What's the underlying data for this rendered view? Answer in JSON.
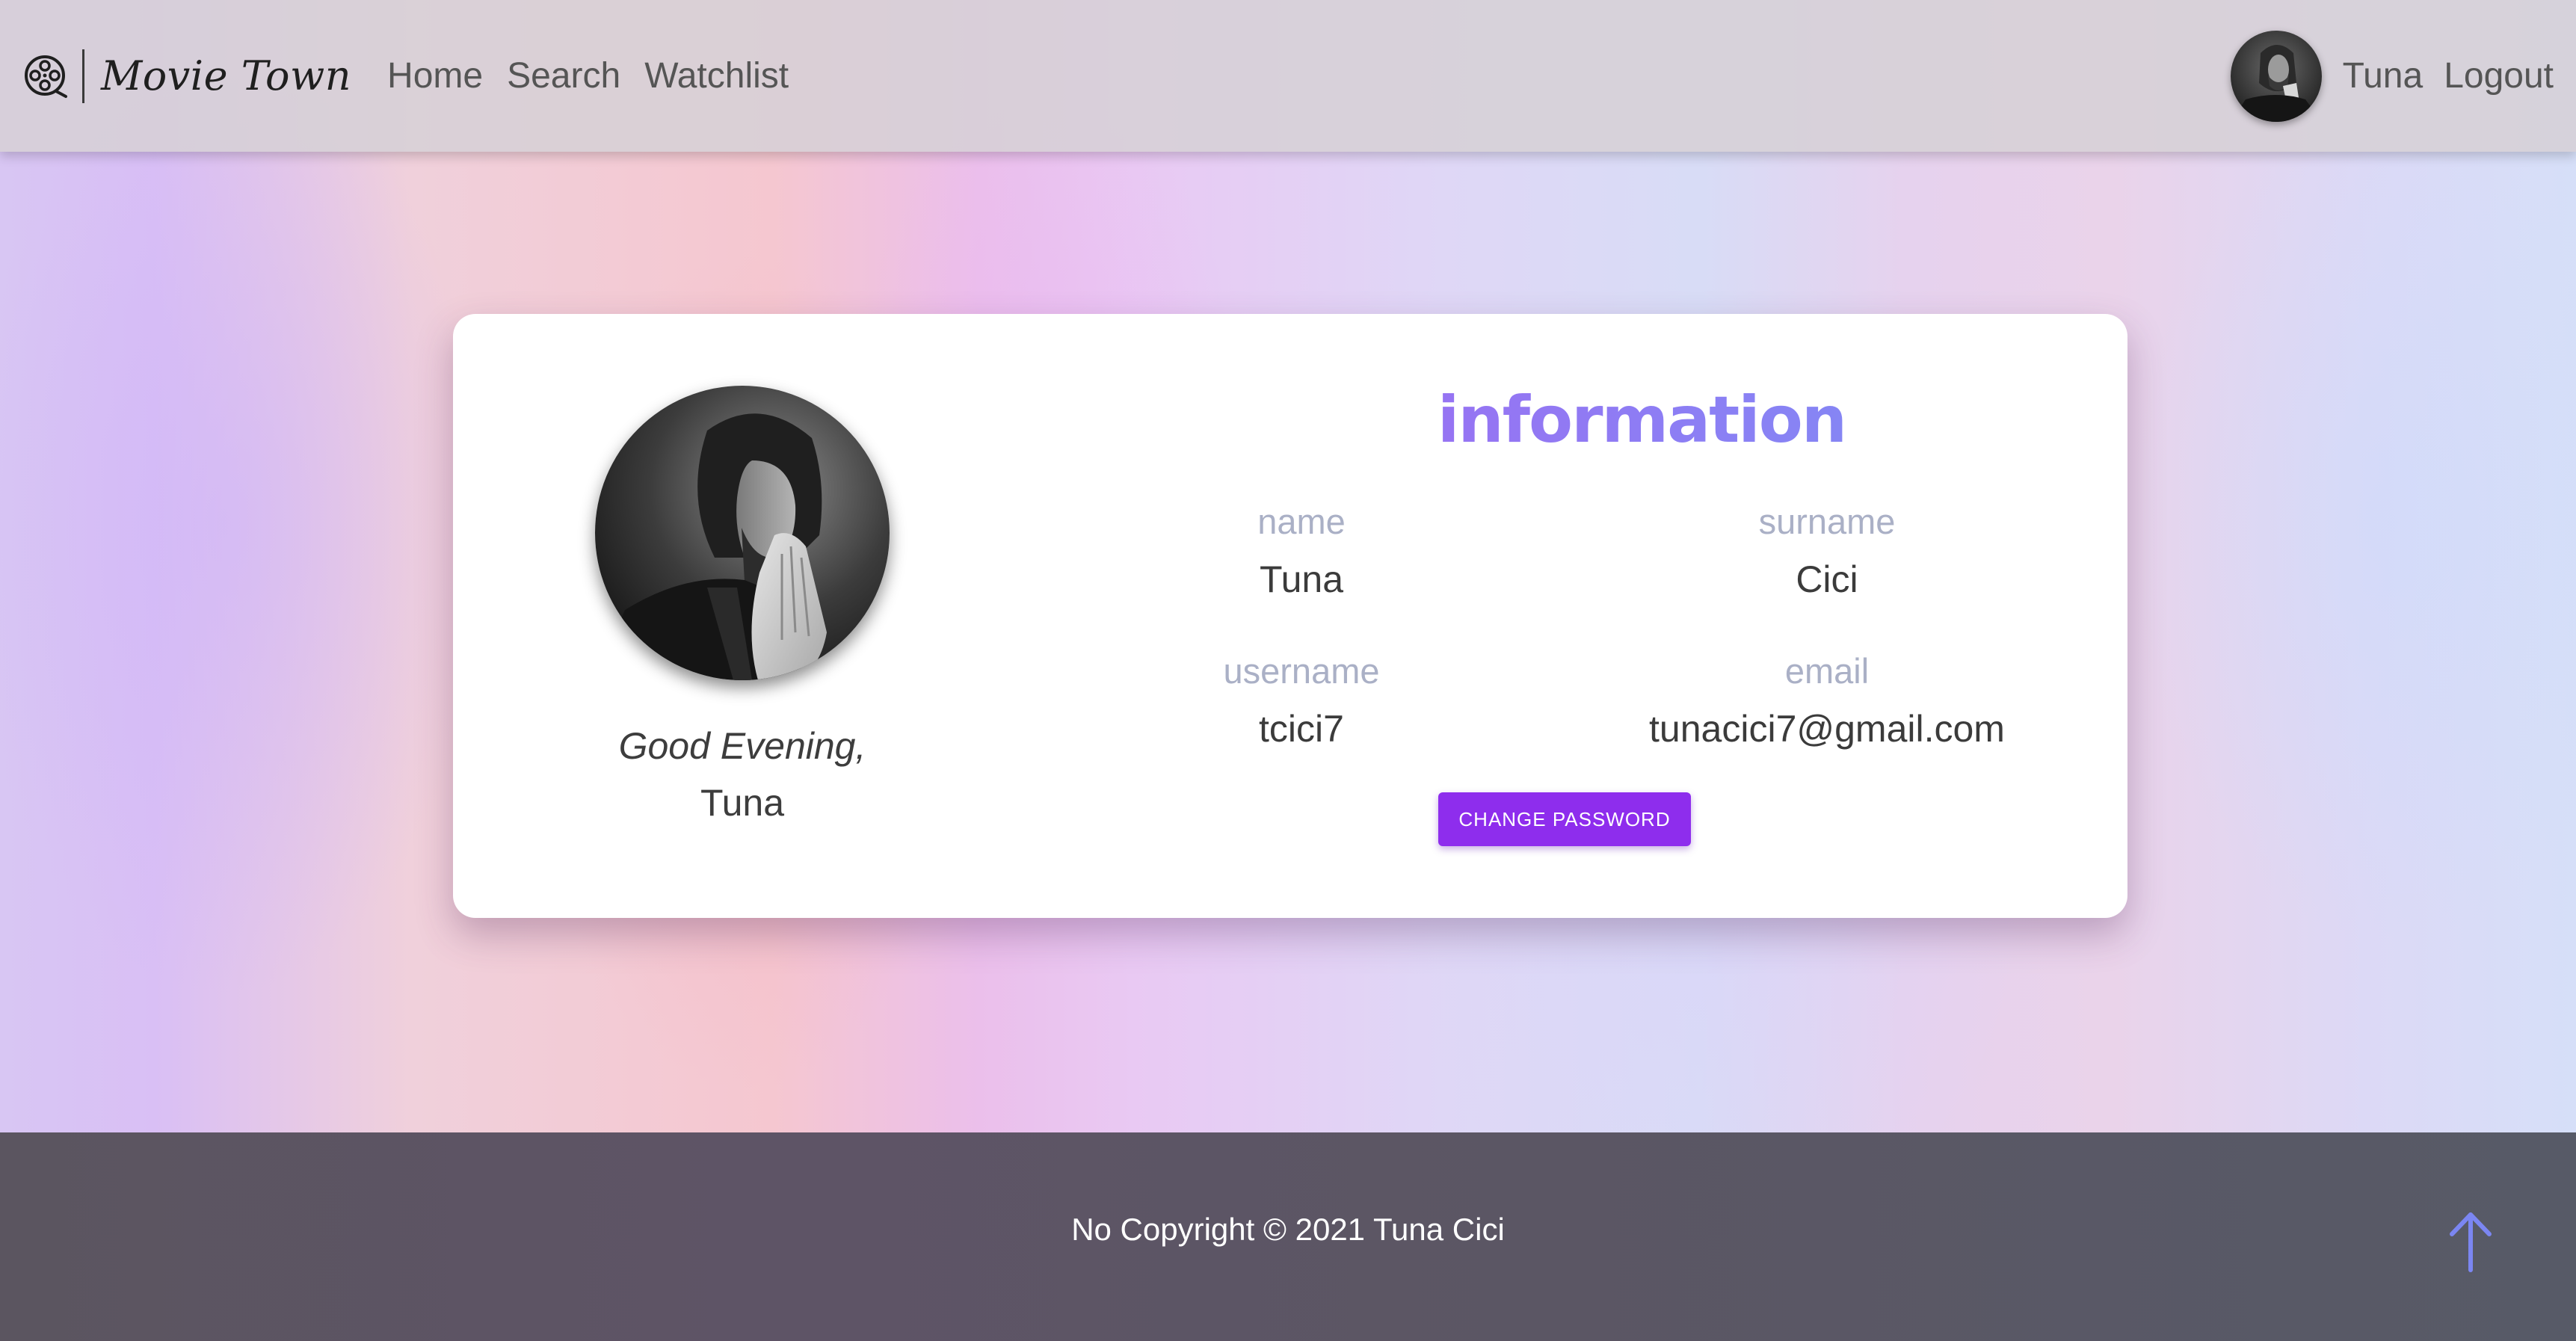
{
  "app": {
    "brand_name": "Movie Town"
  },
  "nav": {
    "links": [
      {
        "label": "Home"
      },
      {
        "label": "Search"
      },
      {
        "label": "Watchlist"
      }
    ],
    "user_name": "Tuna",
    "logout_label": "Logout"
  },
  "profile": {
    "greeting": "Good Evening,",
    "first_name": "Tuna"
  },
  "information": {
    "title": "information",
    "fields": {
      "name": {
        "label": "name",
        "value": "Tuna"
      },
      "surname": {
        "label": "surname",
        "value": "Cici"
      },
      "username": {
        "label": "username",
        "value": "tcici7"
      },
      "email": {
        "label": "email",
        "value": "tunacici7@gmail.com"
      }
    },
    "change_password_label": "CHANGE PASSWORD"
  },
  "footer": {
    "copyright": "No Copyright © 2021 Tuna Cici"
  },
  "icons": {
    "brand": "film-reel-icon",
    "scroll_top": "arrow-up-icon"
  },
  "colors": {
    "accent_purple": "#8e2ded",
    "title_gradient_start": "#9d6df2",
    "title_gradient_end": "#7f8cf5",
    "label_gray": "#aab0c6",
    "scroll_arrow": "#7b86f2"
  }
}
